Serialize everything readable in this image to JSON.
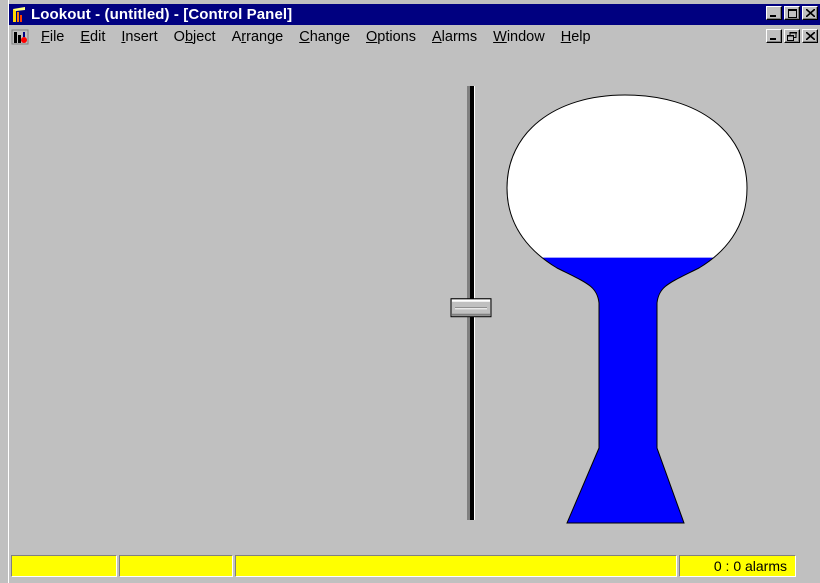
{
  "window": {
    "title": "Lookout - (untitled) - [Control Panel]"
  },
  "menu": {
    "items": [
      {
        "label": "File",
        "key": "F",
        "rest": "ile"
      },
      {
        "label": "Edit",
        "key": "E",
        "rest": "dit"
      },
      {
        "label": "Insert",
        "key": "I",
        "rest": "nsert"
      },
      {
        "label": "Object",
        "pre": "O",
        "key": "b",
        "rest": "ject"
      },
      {
        "label": "Arrange",
        "pre": "A",
        "key": "r",
        "rest": "range"
      },
      {
        "label": "Change",
        "key": "C",
        "rest": "hange"
      },
      {
        "label": "Options",
        "key": "O",
        "rest": "ptions"
      },
      {
        "label": "Alarms",
        "key": "A",
        "rest": "larms"
      },
      {
        "label": "Window",
        "key": "W",
        "rest": "indow"
      },
      {
        "label": "Help",
        "key": "H",
        "rest": "elp"
      }
    ]
  },
  "controls": {
    "slider_level": 0.42,
    "tank_level": 0.62
  },
  "colors": {
    "titlebar": "#000080",
    "liquid": "#0000ff",
    "status_panel": "#ffff00"
  },
  "status": {
    "panel1": "",
    "panel2": "",
    "panel3": "",
    "alarms": "0 : 0 alarms"
  }
}
